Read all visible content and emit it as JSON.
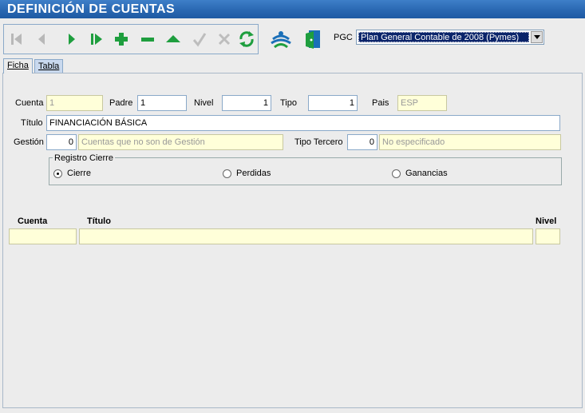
{
  "window": {
    "title": "DEFINICIÓN DE CUENTAS"
  },
  "toolbar": {
    "buttons": [
      "first-icon",
      "previous-icon",
      "next-icon",
      "last-icon",
      "add-icon",
      "delete-icon",
      "up-icon",
      "confirm-icon",
      "cancel-icon",
      "refresh-icon",
      "tree-icon",
      "exit-icon"
    ],
    "pgc_label": "PGC",
    "pgc_value": "Plan General Contable de 2008 (Pymes)"
  },
  "tabs": [
    {
      "label": "Ficha",
      "active": true
    },
    {
      "label": "Tabla",
      "active": false
    }
  ],
  "form": {
    "cuenta_label": "Cuenta",
    "cuenta_value": "1",
    "padre_label": "Padre",
    "padre_value": "1",
    "nivel_label": "Nivel",
    "nivel_value": "1",
    "tipo_label": "Tipo",
    "tipo_value": "1",
    "pais_label": "Pais",
    "pais_value": "ESP",
    "titulo_label": "Título",
    "titulo_value": "FINANCIACIÓN BÁSICA",
    "gestion_label": "Gestión",
    "gestion_value": "0",
    "gestion_desc": "Cuentas que no son de Gestión",
    "tipo_tercero_label": "Tipo Tercero",
    "tipo_tercero_value": "0",
    "tipo_tercero_desc": "No especificado"
  },
  "registro_cierre": {
    "legend": "Registro Cierre",
    "options": [
      "Cierre",
      "Perdidas",
      "Ganancias"
    ],
    "selected": "Cierre"
  },
  "grid": {
    "headers": [
      "Cuenta",
      "Título",
      "Nivel"
    ]
  },
  "colors": {
    "title_bar": "#2a68b2",
    "readonly_bg": "#ffffd9",
    "accent_green": "#1e9e3e"
  }
}
